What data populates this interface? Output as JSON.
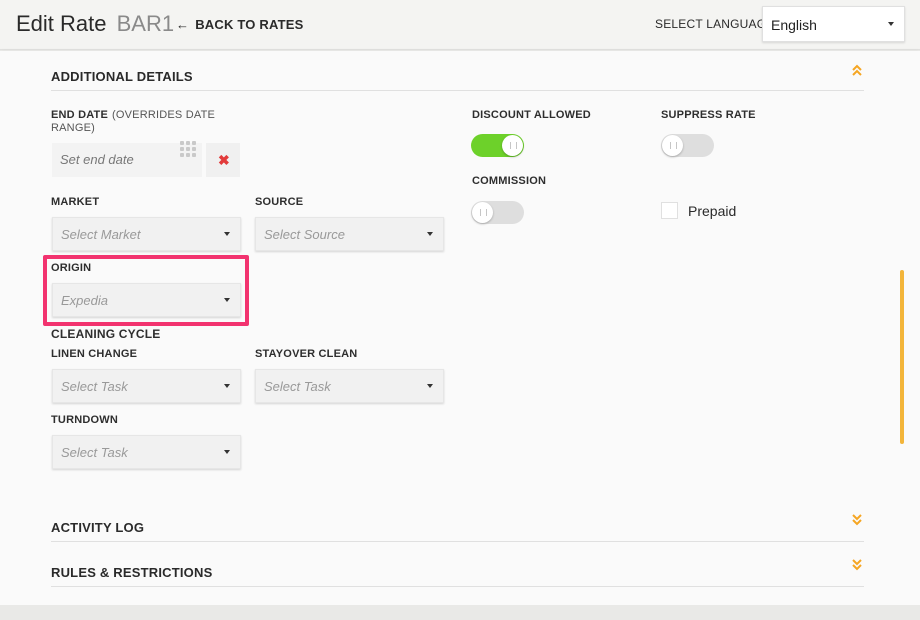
{
  "header": {
    "title": "Edit Rate",
    "rate_code": "BAR1",
    "back_label": "BACK TO RATES",
    "back_arrow": "🡐",
    "language_label": "SELECT LANGUAGE",
    "language_value": "English"
  },
  "additional_details": {
    "title": "ADDITIONAL DETAILS",
    "end_date_label": "END DATE",
    "end_date_sub": "(OVERRIDES DATE",
    "end_date_sub2": "RANGE)",
    "end_date_placeholder": "Set end date",
    "clear_glyph": "✖",
    "market_label": "MARKET",
    "market_placeholder": "Select Market",
    "source_label": "SOURCE",
    "source_placeholder": "Select Source",
    "origin_label": "ORIGIN",
    "origin_value": "Expedia",
    "discount_label": "DISCOUNT ALLOWED",
    "discount_on": true,
    "suppress_label": "SUPPRESS RATE",
    "suppress_on": false,
    "commission_label": "COMMISSION",
    "commission_on": false,
    "prepaid_label": "Prepaid",
    "prepaid_checked": false
  },
  "cleaning_cycle": {
    "title": "CLEANING CYCLE",
    "linen_label": "LINEN CHANGE",
    "linen_placeholder": "Select Task",
    "stayover_label": "STAYOVER CLEAN",
    "stayover_placeholder": "Select Task",
    "turndown_label": "TURNDOWN",
    "turndown_placeholder": "Select Task"
  },
  "sections": {
    "activity_log": "ACTIVITY LOG",
    "rules": "RULES & RESTRICTIONS"
  },
  "icons": {
    "collapse": "chevron-double-up-icon",
    "expand": "chevron-double-down-icon",
    "calendar": "calendar-grid-icon",
    "accent_color": "#f5a623",
    "toggle_on_color": "#6dd12a",
    "highlight_color": "#f2336f"
  }
}
